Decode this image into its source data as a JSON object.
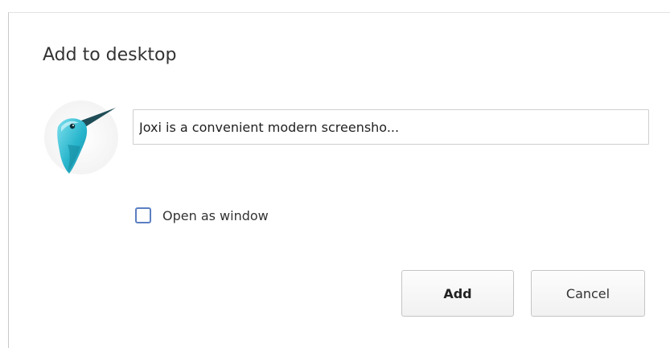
{
  "dialog": {
    "title": "Add to desktop",
    "app_icon": "joxi-bird-icon",
    "name_field": {
      "value": "Joxi is a convenient modern screensho..."
    },
    "open_as_window": {
      "label": "Open as window",
      "checked": false
    },
    "buttons": {
      "add_label": "Add",
      "cancel_label": "Cancel"
    }
  },
  "colors": {
    "checkbox_border": "#5b7fc2",
    "icon_teal": "#2fb3c8"
  }
}
